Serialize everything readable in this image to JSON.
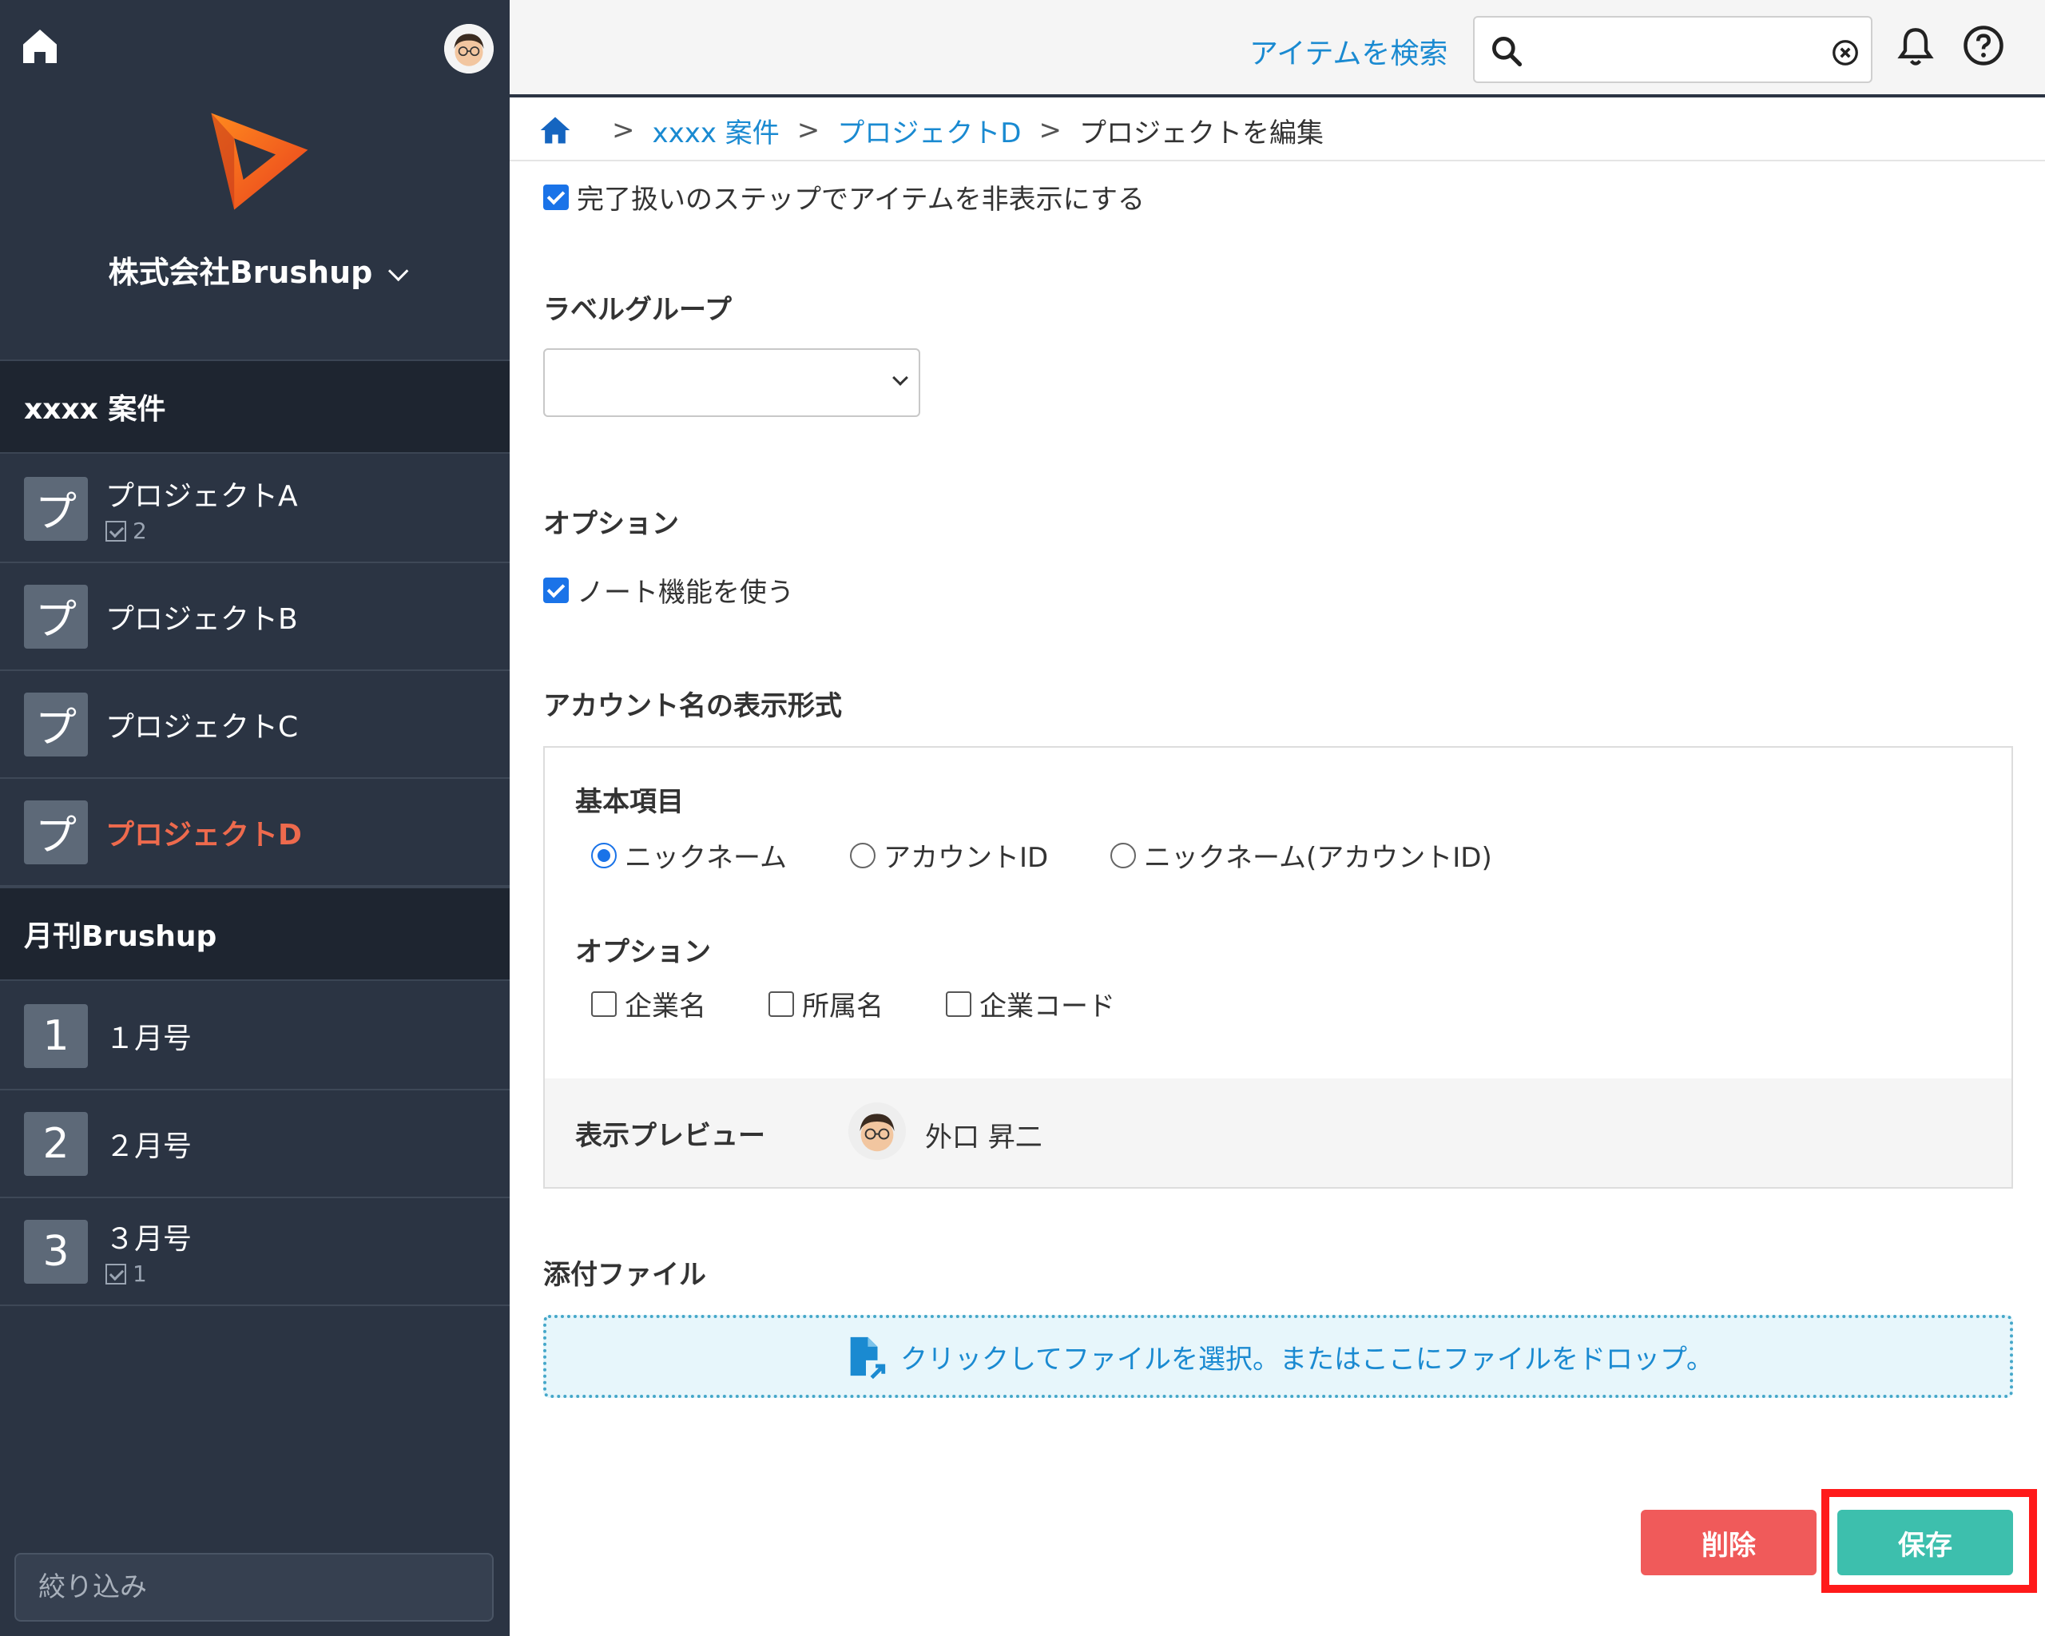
{
  "sidebar": {
    "org_name": "株式会社Brushup",
    "groups": [
      {
        "title": "xxxx 案件",
        "items": [
          {
            "tile": "プ",
            "name": "プロジェクトA",
            "count": "2"
          },
          {
            "tile": "プ",
            "name": "プロジェクトB",
            "count": ""
          },
          {
            "tile": "プ",
            "name": "プロジェクトC",
            "count": ""
          },
          {
            "tile": "プ",
            "name": "プロジェクトD",
            "count": "",
            "active": true
          }
        ]
      },
      {
        "title": "月刊Brushup",
        "items": [
          {
            "tile": "1",
            "name": "１月号",
            "count": ""
          },
          {
            "tile": "2",
            "name": "２月号",
            "count": ""
          },
          {
            "tile": "3",
            "name": "３月号",
            "count": "1"
          }
        ]
      }
    ],
    "filter_placeholder": "絞り込み",
    "active_color": "#ee6a4d"
  },
  "topbar": {
    "search_label": "アイテムを検索",
    "search_value": ""
  },
  "breadcrumb": {
    "items": [
      "xxxx 案件",
      "プロジェクトD"
    ],
    "current": "プロジェクトを編集",
    "separator": ">"
  },
  "form": {
    "hide_completed_label": "完了扱いのステップでアイテムを非表示にする",
    "hide_completed_checked": true,
    "label_group_title": "ラベルグループ",
    "label_group_value": "",
    "options_title": "オプション",
    "note_feature_label": "ノート機能を使う",
    "note_feature_checked": true,
    "account_format_title": "アカウント名の表示形式",
    "basic_title": "基本項目",
    "basic_options": [
      "ニックネーム",
      "アカウントID",
      "ニックネーム(アカウントID)"
    ],
    "basic_selected": "ニックネーム",
    "extra_title": "オプション",
    "extra_options": [
      "企業名",
      "所属名",
      "企業コード"
    ],
    "preview_title": "表示プレビュー",
    "preview_name": "外口 昇二",
    "attachments_title": "添付ファイル",
    "dropzone_text": "クリックしてファイルを選択。またはここにファイルをドロップ。"
  },
  "actions": {
    "delete_label": "削除",
    "save_label": "保存"
  },
  "colors": {
    "link": "#1a8ad1",
    "delete": "#f05a5a",
    "save": "#3dbfad",
    "highlight": "#ff1a1a"
  }
}
